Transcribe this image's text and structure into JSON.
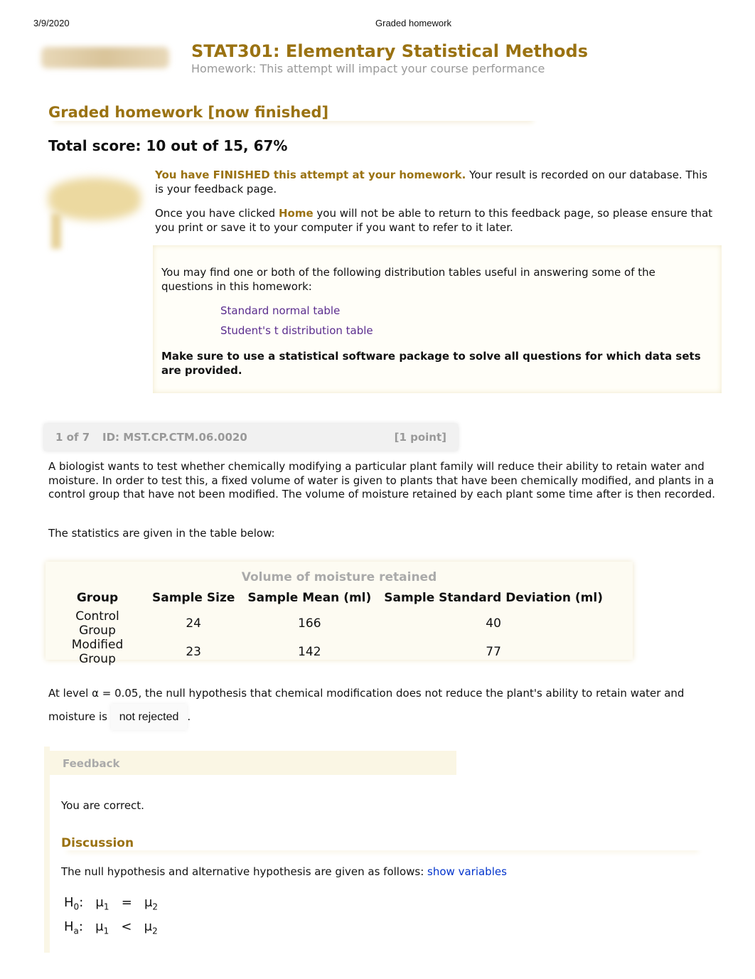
{
  "browser": {
    "date": "3/9/2020",
    "title": "Graded homework"
  },
  "header": {
    "course": "STAT301: Elementary Statistical Methods",
    "subtitle": "Homework: This attempt will impact your course performance"
  },
  "page_title": "Graded homework [now finished]",
  "total_score": "Total score: 10 out of 15, 67%",
  "intro": {
    "finished_bold": "You have FINISHED this attempt at your homework.",
    "finished_rest": " Your result is recorded on our database. This is your feedback page.",
    "once_pre": "Once you have clicked ",
    "home": "Home",
    "once_post": " you will not be able to return to this feedback page, so please ensure that you print or save it to your computer if you want to refer to it later."
  },
  "tables_box": {
    "text": "You may find one or both of the following distribution tables useful in answering some of the questions in this homework:",
    "links": [
      "Standard normal table",
      "Student's t distribution table"
    ],
    "note": "Make sure to use a statistical software package to solve all questions for which data sets are provided."
  },
  "question": {
    "number": "1 of 7",
    "id": "ID: MST.CP.CTM.06.0020",
    "points": "[1 point]",
    "text": "A biologist wants to test whether chemically modifying a particular plant family will reduce their ability to retain water and moisture. In order to test this, a fixed volume of water is given to plants that have been chemically modified, and plants in a control group that have not been modified. The volume of moisture retained by each plant some time after is then recorded.",
    "stats_intro": "The statistics are given in the table below:",
    "table": {
      "caption": "Volume of moisture retained",
      "headers": [
        "Group",
        "Sample Size",
        "Sample Mean (ml)",
        "Sample Standard Deviation (ml)"
      ],
      "rows": [
        [
          "Control Group",
          "24",
          "166",
          "40"
        ],
        [
          "Modified Group",
          "23",
          "142",
          "77"
        ]
      ]
    },
    "prompt_pre": "At level α = 0.05, the null hypothesis that chemical modification does not reduce the plant's ability to retain water and moisture is ",
    "answer": "not rejected",
    "prompt_post": "."
  },
  "feedback": {
    "title": "Feedback",
    "result": "You are correct.",
    "discussion_title": "Discussion",
    "discussion_text": "The null hypothesis and alternative hypothesis are given as follows: ",
    "show_variables": "show variables",
    "h0": {
      "label": "H",
      "sub": "0",
      "lhs": "μ",
      "lsub": "1",
      "op": "=",
      "rhs": "μ",
      "rsub": "2"
    },
    "ha": {
      "label": "H",
      "sub": "a",
      "lhs": "μ",
      "lsub": "1",
      "op": "<",
      "rhs": "μ",
      "rsub": "2"
    }
  }
}
